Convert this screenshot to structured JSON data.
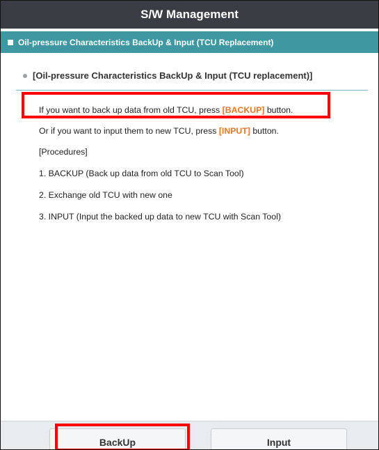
{
  "window": {
    "title": "S/W Management"
  },
  "subheader": {
    "title": "Oil-pressure Characteristics BackUp & Input (TCU Replacement)"
  },
  "section": {
    "title": "[Oil-pressure Characteristics BackUp & Input (TCU replacement)]"
  },
  "instructions": {
    "line1_pre": "If you want to back up data from old TCU, press ",
    "line1_hl": "[BACKUP]",
    "line1_post": " button.",
    "line2_pre": "Or if you want to input them to new TCU, press ",
    "line2_hl": "[INPUT]",
    "line2_post": " button.",
    "procedures_header": "[Procedures]",
    "steps": [
      "1. BACKUP (Back up data from old TCU to Scan Tool)",
      "2. Exchange old TCU with new one",
      "3. INPUT (Input the backed up data to new TCU with Scan Tool)"
    ]
  },
  "buttons": {
    "backup": "BackUp",
    "input": "Input"
  },
  "colors": {
    "titlebar": "#3a3e44",
    "subheader": "#3e97a1",
    "highlight": "#e87722",
    "callout": "#ff0000"
  }
}
